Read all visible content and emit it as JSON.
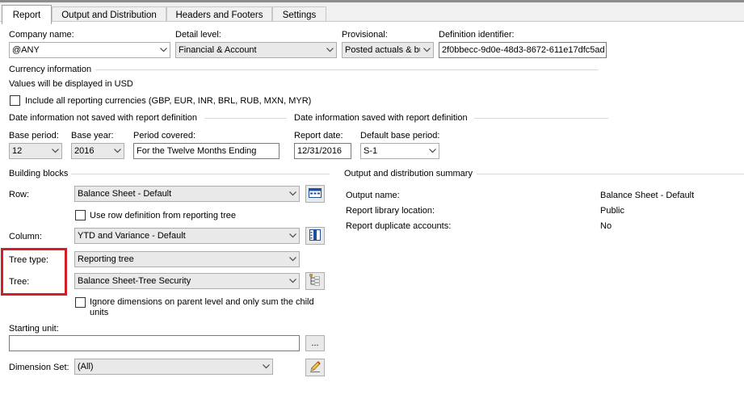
{
  "tabs": [
    {
      "label": "Report",
      "active": true
    },
    {
      "label": "Output and Distribution",
      "active": false
    },
    {
      "label": "Headers and Footers",
      "active": false
    },
    {
      "label": "Settings",
      "active": false
    }
  ],
  "fields": {
    "company_name": {
      "label": "Company name:",
      "value": "@ANY"
    },
    "detail_level": {
      "label": "Detail level:",
      "value": "Financial & Account"
    },
    "provisional": {
      "label": "Provisional:",
      "value": "Posted actuals & bu"
    },
    "definition_identifier": {
      "label": "Definition identifier:",
      "value": "2f0bbecc-9d0e-48d3-8672-611e17dfc5ad"
    }
  },
  "currency": {
    "heading": "Currency information",
    "note": "Values will be displayed in USD",
    "include_all_label": "Include all reporting currencies (GBP, EUR, INR, BRL, RUB, MXN, MYR)",
    "include_all_checked": false
  },
  "date_not_saved": {
    "heading": "Date information not saved with report definition",
    "base_period": {
      "label": "Base period:",
      "value": "12"
    },
    "base_year": {
      "label": "Base year:",
      "value": "2016"
    },
    "period_covered": {
      "label": "Period covered:",
      "value": "For the Twelve Months Ending"
    }
  },
  "date_saved": {
    "heading": "Date information saved with report definition",
    "report_date": {
      "label": "Report date:",
      "value": "12/31/2016"
    },
    "default_base_period": {
      "label": "Default base period:",
      "value": "S-1"
    }
  },
  "building_blocks": {
    "heading": "Building blocks",
    "row": {
      "label": "Row:",
      "value": "Balance Sheet - Default"
    },
    "use_row_def_label": "Use row definition from reporting tree",
    "use_row_def_checked": false,
    "column": {
      "label": "Column:",
      "value": "YTD and Variance - Default"
    },
    "tree_type": {
      "label": "Tree type:",
      "value": "Reporting tree"
    },
    "tree": {
      "label": "Tree:",
      "value": "Balance Sheet-Tree Security"
    },
    "ignore_dims_label_line1": "Ignore dimensions on parent level and only sum the child",
    "ignore_dims_label_line2": "units",
    "ignore_dims_checked": false,
    "starting_unit": {
      "label": "Starting unit:",
      "value": "",
      "browse_label": "..."
    },
    "dimension_set": {
      "label": "Dimension Set:",
      "value": "(All)"
    }
  },
  "summary": {
    "heading": "Output and distribution summary",
    "rows": [
      {
        "key": "Output name:",
        "value": "Balance Sheet - Default"
      },
      {
        "key": "Report library location:",
        "value": "Public"
      },
      {
        "key": "Report duplicate accounts:",
        "value": "No"
      }
    ]
  },
  "colors": {
    "highlight": "#d21f26",
    "panel": "#ffffff",
    "chrome": "#f0f0f0"
  }
}
